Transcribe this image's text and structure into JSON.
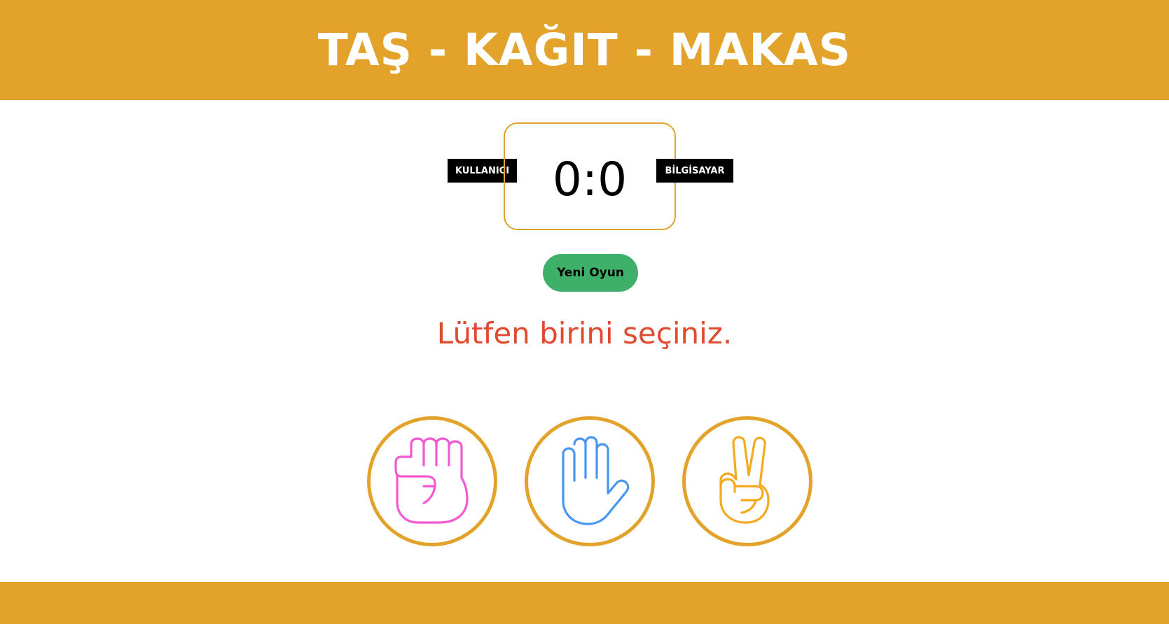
{
  "header": {
    "title": "TAŞ - KAĞIT - MAKAS"
  },
  "scoreboard": {
    "user_label": "KULLANICI",
    "computer_label": "BİLGİSAYAR",
    "score": "0:0"
  },
  "controls": {
    "new_game_label": "Yeni Oyun"
  },
  "message": "Lütfen birini seçiniz.",
  "choices": [
    {
      "name": "rock",
      "icon": "fist-icon",
      "color": "#f558d3"
    },
    {
      "name": "paper",
      "icon": "open-hand-icon",
      "color": "#4797f2"
    },
    {
      "name": "scissors",
      "icon": "victory-hand-icon",
      "color": "#f4a91e"
    }
  ],
  "colors": {
    "accent": "#e3a32a",
    "button": "#3fb06a",
    "message": "#e04a2e"
  }
}
